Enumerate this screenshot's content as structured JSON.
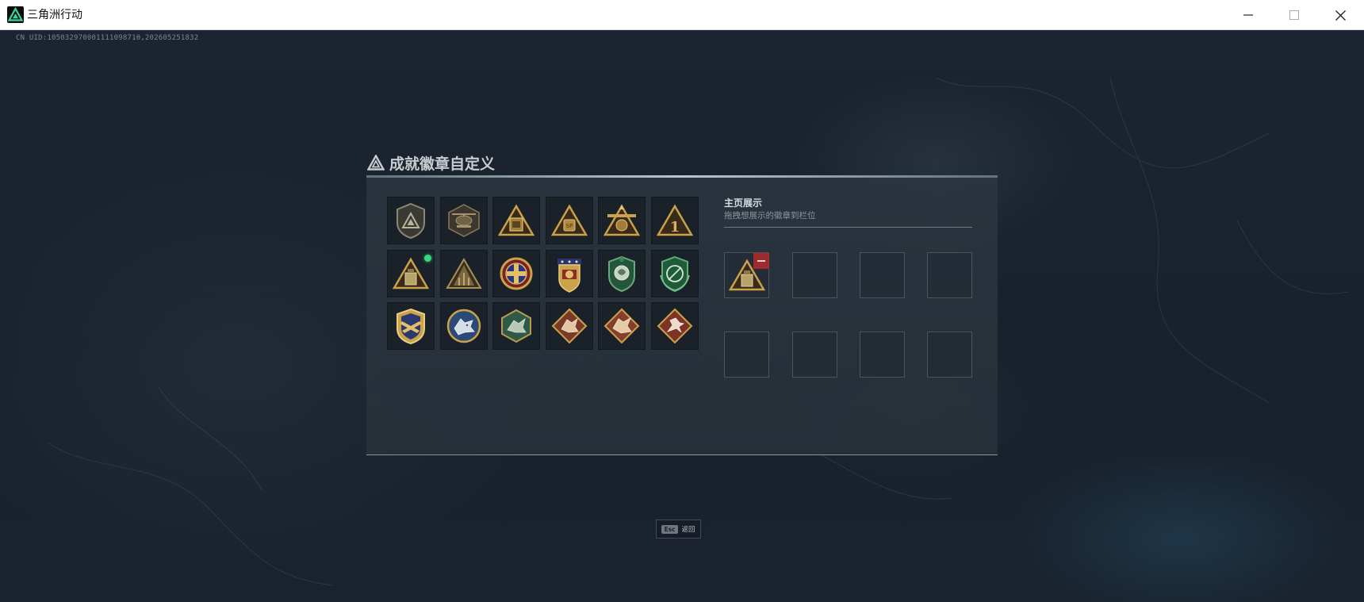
{
  "window": {
    "title": "三角洲行动",
    "controls": [
      "minimize",
      "maximize",
      "close"
    ]
  },
  "uid_text": "CN UID:10503297000111109871θ,202605251832",
  "panel": {
    "title": "成就徽章自定义",
    "badges": [
      {
        "icon": "pyramid-shield-badge",
        "new": false
      },
      {
        "icon": "helicopter-badge",
        "new": false
      },
      {
        "icon": "golden-triangle-vault-badge",
        "new": false
      },
      {
        "icon": "golden-triangle-crest-badge",
        "new": false
      },
      {
        "icon": "golden-triangle-emblem-badge",
        "new": false
      },
      {
        "icon": "triangle-number-one-badge",
        "new": false
      },
      {
        "icon": "triangle-vault-badge",
        "new": true
      },
      {
        "icon": "triangle-building-badge",
        "new": false
      },
      {
        "icon": "cross-medal-badge",
        "new": false
      },
      {
        "icon": "star-shield-medal-badge",
        "new": false
      },
      {
        "icon": "green-lion-shield-badge",
        "new": false
      },
      {
        "icon": "green-wreath-shield-badge",
        "new": false
      },
      {
        "icon": "navy-gold-crest-badge",
        "new": false
      },
      {
        "icon": "wolf-circle-badge",
        "new": false
      },
      {
        "icon": "green-hexagon-beast-badge",
        "new": false
      },
      {
        "icon": "diamond-dragon-badge",
        "new": false
      },
      {
        "icon": "diamond-dragon-badge-2",
        "new": false
      },
      {
        "icon": "diamond-runner-badge",
        "new": false
      }
    ],
    "showcase": {
      "title": "主页展示",
      "subtitle": "拖拽想展示的徽章到栏位",
      "slots": [
        {
          "filled": true,
          "icon": "triangle-vault-badge"
        },
        {
          "filled": false
        },
        {
          "filled": false
        },
        {
          "filled": false
        },
        {
          "filled": false
        },
        {
          "filled": false
        },
        {
          "filled": false
        },
        {
          "filled": false
        }
      ]
    }
  },
  "footer": {
    "esc_key": "Esc",
    "back_label": "返回"
  },
  "colors": {
    "background": "#1b2430",
    "panel": "#2c3640",
    "gold": "#c9a24a",
    "green_dot": "#38d97a",
    "remove_red": "#a12a2f"
  }
}
